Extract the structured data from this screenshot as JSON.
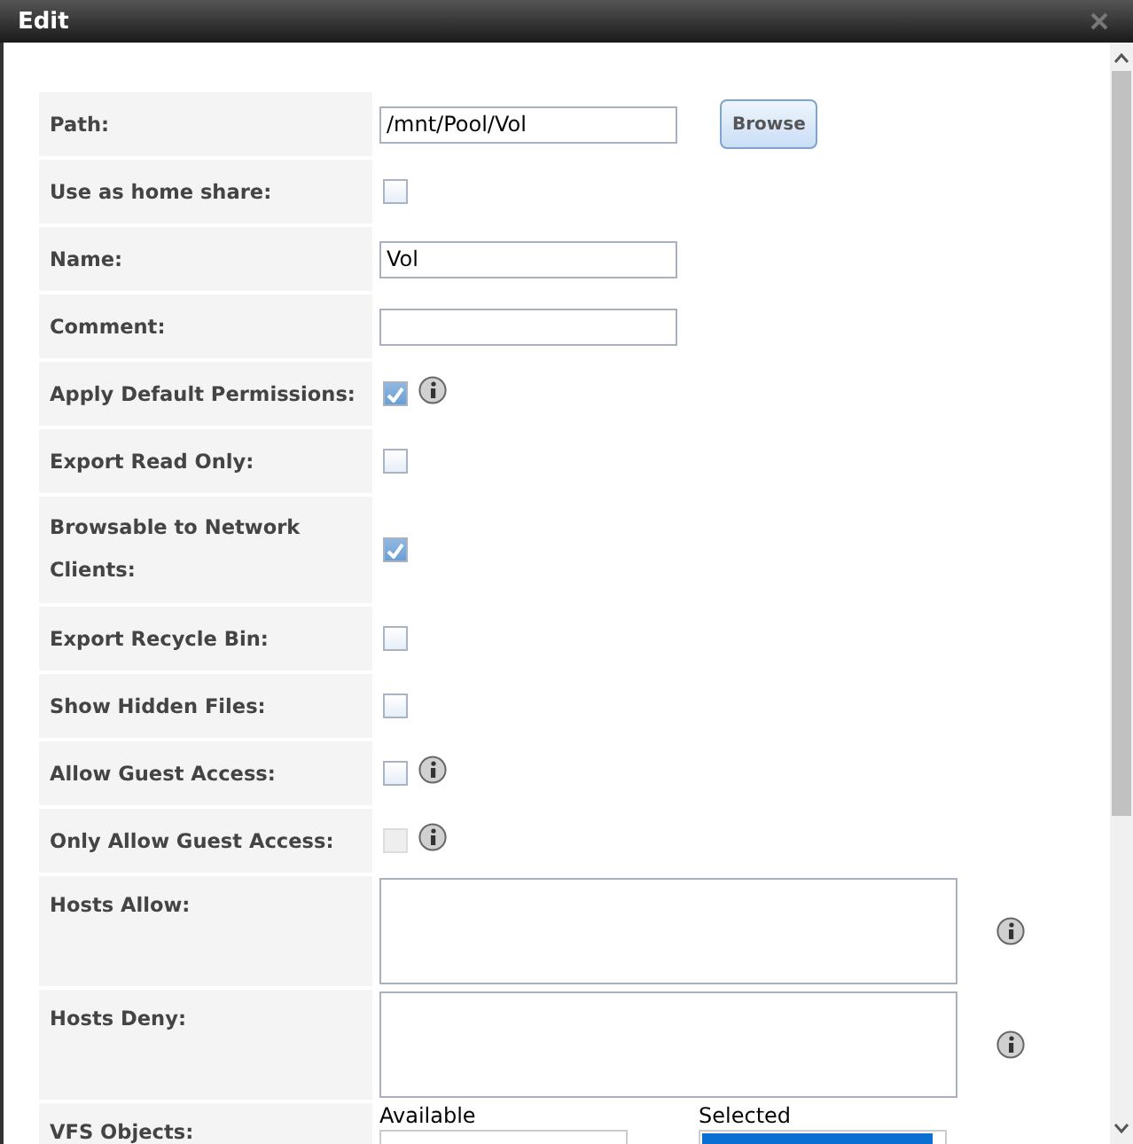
{
  "window": {
    "title": "Edit"
  },
  "rows": [
    {
      "kind": "text",
      "label": "Path:",
      "value": "/mnt/Pool/Vol",
      "button": "Browse"
    },
    {
      "kind": "checkbox",
      "label": "Use as home share:",
      "checked": false,
      "disabled": false,
      "info": false
    },
    {
      "kind": "text",
      "label": "Name:",
      "value": "Vol"
    },
    {
      "kind": "text",
      "label": "Comment:"
    },
    {
      "kind": "checkbox",
      "label": "Apply Default Permissions:",
      "checked": true,
      "disabled": false,
      "info": true
    },
    {
      "kind": "checkbox",
      "label": "Export Read Only:",
      "checked": false,
      "disabled": false,
      "info": false
    },
    {
      "kind": "checkbox",
      "label": "Browsable to Network Clients:",
      "checked": true,
      "disabled": false,
      "info": false,
      "tall": true
    },
    {
      "kind": "checkbox",
      "label": "Export Recycle Bin:",
      "checked": false,
      "disabled": false,
      "info": false
    },
    {
      "kind": "checkbox",
      "label": "Show Hidden Files:",
      "checked": false,
      "disabled": false,
      "info": false
    },
    {
      "kind": "checkbox",
      "label": "Allow Guest Access:",
      "checked": false,
      "disabled": false,
      "info": true
    },
    {
      "kind": "checkbox",
      "label": "Only Allow Guest Access:",
      "checked": false,
      "disabled": true,
      "info": true
    },
    {
      "kind": "textarea",
      "label": "Hosts Allow:",
      "info": true
    },
    {
      "kind": "textarea",
      "label": "Hosts Deny:",
      "info": true
    },
    {
      "kind": "lists",
      "label": "VFS Objects:",
      "available": "Available",
      "selected": "Selected",
      "highlighted": true
    }
  ]
}
